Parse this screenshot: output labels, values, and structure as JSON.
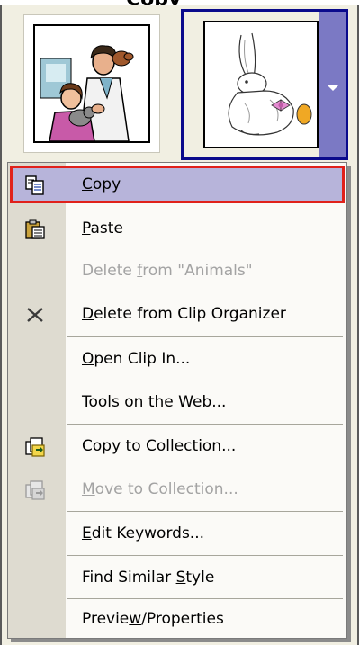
{
  "window": {
    "title_fragment": "Copy"
  },
  "clips": [
    {
      "name": "veterinarian-clip",
      "description_visible": false
    },
    {
      "name": "rabbit-clip",
      "selected": true
    }
  ],
  "context_menu": {
    "items": [
      {
        "pre": "",
        "u": "C",
        "post": "opy",
        "icon": "copy-icon",
        "enabled": true,
        "selected": true
      },
      {
        "pre": "",
        "u": "P",
        "post": "aste",
        "icon": "paste-icon",
        "enabled": true,
        "selected": false
      },
      {
        "pre": "Delete ",
        "u": "f",
        "post": "rom \"Animals\"",
        "icon": "",
        "enabled": false,
        "selected": false
      },
      {
        "pre": "",
        "u": "D",
        "post": "elete from Clip Organizer",
        "icon": "delete-x-icon",
        "enabled": true,
        "selected": false
      },
      {
        "pre": "",
        "u": "O",
        "post": "pen Clip In...",
        "icon": "",
        "enabled": true,
        "selected": false
      },
      {
        "pre": "Tools on the We",
        "u": "b",
        "post": "...",
        "icon": "",
        "enabled": true,
        "selected": false
      },
      {
        "pre": "Cop",
        "u": "y",
        "post": " to Collection...",
        "icon": "copy-to-collection-icon",
        "enabled": true,
        "selected": false
      },
      {
        "pre": "",
        "u": "M",
        "post": "ove to Collection...",
        "icon": "move-to-collection-icon",
        "enabled": false,
        "selected": false
      },
      {
        "pre": "",
        "u": "E",
        "post": "dit Keywords...",
        "icon": "",
        "enabled": true,
        "selected": false
      },
      {
        "pre": "Find Similar ",
        "u": "S",
        "post": "tyle",
        "icon": "",
        "enabled": true,
        "selected": false
      },
      {
        "pre": "Previe",
        "u": "w",
        "post": "/Properties",
        "icon": "",
        "enabled": true,
        "selected": false
      }
    ]
  },
  "colors": {
    "highlight": "#b7b4da",
    "highlight_outline": "#e0211b",
    "dropdown": "#7b79c4",
    "selected_border": "#0a0a8c",
    "gutter": "#dedbd0",
    "disabled_text": "#a3a3a3"
  }
}
